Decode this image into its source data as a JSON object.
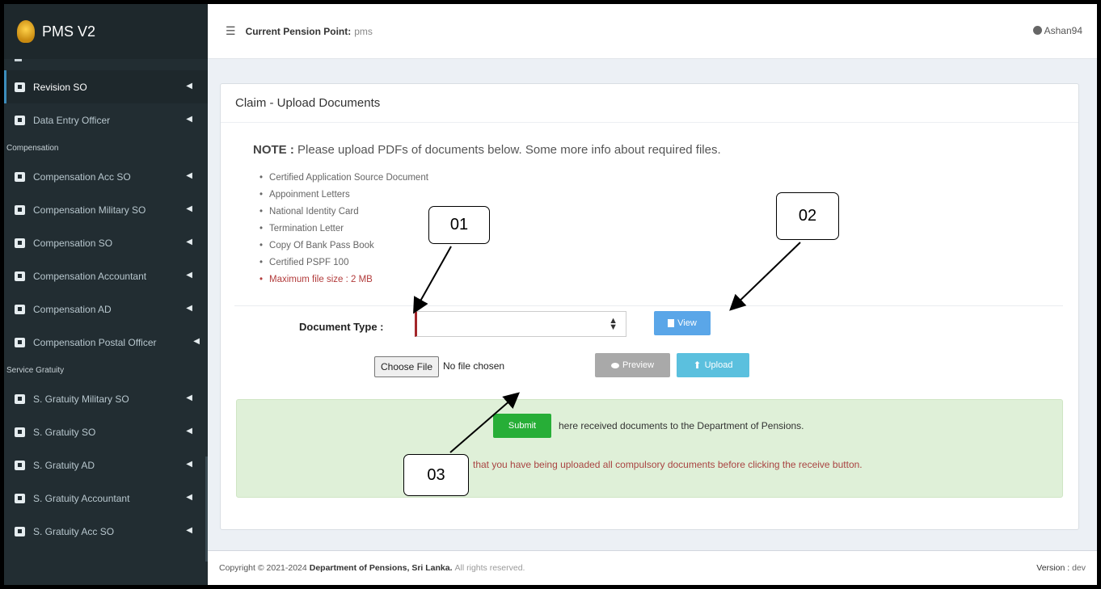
{
  "app": {
    "brand": "PMS V2"
  },
  "topbar": {
    "menu_icon": "hamburger-icon",
    "pension_point_label": "Current Pension Point:",
    "pension_point_value": "pms",
    "user": "Ashan94"
  },
  "sidebar": {
    "items": [
      {
        "label": "Revision SO",
        "icon": "file-icon",
        "active": true
      },
      {
        "label": "Data Entry Officer",
        "icon": "users-icon"
      },
      {
        "section": "Compensation"
      },
      {
        "label": "Compensation Acc SO",
        "icon": "file-icon"
      },
      {
        "label": "Compensation Military SO",
        "icon": "archive-icon"
      },
      {
        "label": "Compensation SO",
        "icon": "list-icon"
      },
      {
        "label": "Compensation Accountant",
        "icon": "file-icon"
      },
      {
        "label": "Compensation AD",
        "icon": "id-card-icon"
      },
      {
        "label": "Compensation Postal Officer",
        "icon": "file-icon"
      },
      {
        "section": "Service Gratuity"
      },
      {
        "label": "S. Gratuity Military SO",
        "icon": "handshake-icon"
      },
      {
        "label": "S. Gratuity SO",
        "icon": "file-icon"
      },
      {
        "label": "S. Gratuity AD",
        "icon": "file-icon"
      },
      {
        "label": "S. Gratuity Accountant",
        "icon": "file-icon"
      },
      {
        "label": "S. Gratuity Acc SO",
        "icon": "sitemap-icon"
      }
    ]
  },
  "main": {
    "title": "Claim - Upload Documents",
    "note_prefix": "NOTE :",
    "note_text": "Please upload PDFs of documents below. Some more info about required files.",
    "documents": [
      "Certified Application Source Document",
      "Appoinment Letters",
      "National Identity Card",
      "Termination Letter",
      "Copy Of Bank Pass Book",
      "Certified PSPF 100"
    ],
    "max_size": "Maximum file size : 2 MB",
    "document_type_label": "Document Type :",
    "document_type_value": "",
    "view_button": "View",
    "choose_file_button": "Choose File",
    "file_status": "No file chosen",
    "preview_button": "Preview",
    "upload_button": "Upload",
    "submit_button": "Submit",
    "submit_text": "here received documents to the Department of Pensions.",
    "warning_text": "that you have being uploaded all compulsory documents before clicking the receive button."
  },
  "callouts": [
    "01",
    "02",
    "03"
  ],
  "footer": {
    "copyright": "Copyright © 2021-2024",
    "org": "Department of Pensions, Sri Lanka.",
    "rights": "All rights reserved.",
    "version_label": "Version :",
    "version_value": "dev"
  },
  "colors": {
    "sidebar_bg": "#222d32",
    "accent": "#3c8dbc",
    "submit_green": "#27ae37",
    "panel_green": "#dff0d8",
    "warning_red": "#a94442"
  }
}
